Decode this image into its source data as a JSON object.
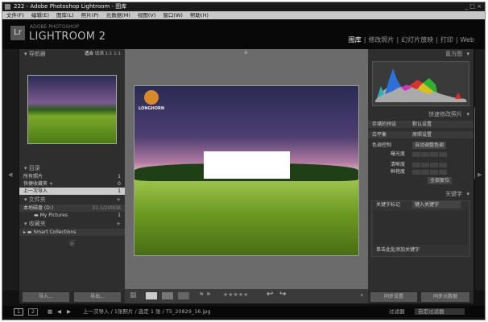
{
  "window": {
    "title": "222 - Adobe Photoshop Lightroom - 图库",
    "controls": "_ □ ×"
  },
  "menu": [
    "文件(F)",
    "编辑(E)",
    "图库(L)",
    "照片(P)",
    "元数据(M)",
    "视图(V)",
    "窗口(W)",
    "帮助(H)"
  ],
  "brand": {
    "line1": "ADOBE PHOTOSHOP",
    "line2": "LIGHTROOM 2",
    "logo": "Lr"
  },
  "modules": [
    "图库",
    "修改照片",
    "幻灯片放映",
    "打印",
    "Web"
  ],
  "navigator": {
    "title": "导航器",
    "zoom": [
      "适合",
      "填满",
      "1:1",
      "1:1"
    ]
  },
  "catalog": {
    "title": "目录",
    "items": [
      {
        "label": "所有照片",
        "count": "1"
      },
      {
        "label": "快捷收藏夹 +",
        "count": "0"
      },
      {
        "label": "上一次导入",
        "count": "1"
      }
    ]
  },
  "folders": {
    "title": "文件夹",
    "disk": "本地磁盘 (D:)",
    "disk_size": "31.1/200GB",
    "items": [
      {
        "label": "My Pictures",
        "count": "1"
      }
    ]
  },
  "collections": {
    "title": "收藏夹",
    "items": [
      "Smart Collections"
    ]
  },
  "left_buttons": {
    "import": "导入...",
    "export": "导出..."
  },
  "photo": {
    "logo_text": "LONGHORN"
  },
  "toolbar": {
    "stars": "★★★★★"
  },
  "histogram": {
    "title": "直方图"
  },
  "quick_develop": {
    "title": "快速修改照片",
    "saved_preset_label": "存储的预设",
    "saved_preset": "默认设置",
    "wb_label": "白平衡",
    "wb": "原照设置",
    "tone_label": "色调控制",
    "auto_tone": "自动调整色调",
    "exposure": "曝光度",
    "clarity": "清晰度",
    "vibrance": "鲜艳度",
    "reset": "全部复位"
  },
  "keywords": {
    "title": "关键字",
    "tags_label": "关键字标记",
    "tags_value": "键入关键字",
    "hint": "单击此处添加关键字"
  },
  "right_buttons": {
    "sync": "同步设置",
    "sync_meta": "同步元数据"
  },
  "filmstrip": {
    "pages": [
      "1",
      "2"
    ],
    "path": "上一次导入 / 1张照片 / 选定 1 张 / T5_20829_16.jpg",
    "filter_label": "过滤器",
    "filter": "自定过滤器"
  }
}
